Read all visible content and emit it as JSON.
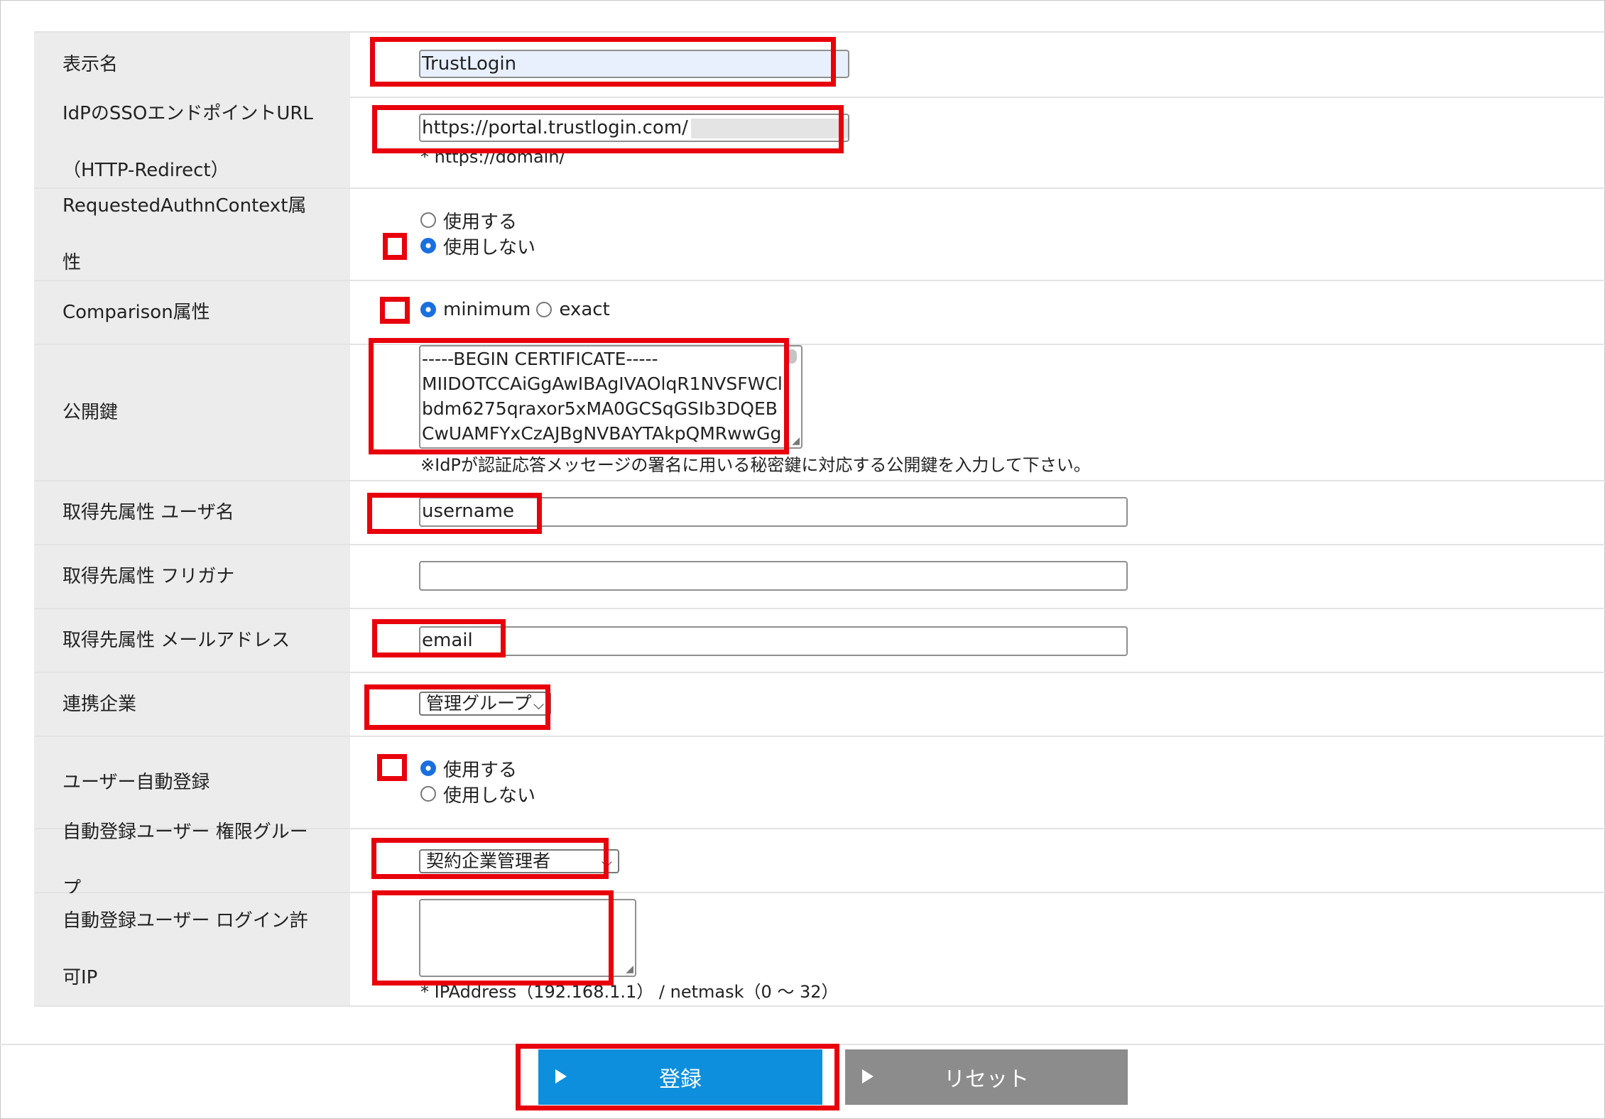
{
  "form": {
    "display_name": {
      "label": "表示名",
      "value": "TrustLogin"
    },
    "sso_url": {
      "label_line1": "IdPのSSOエンドポイントURL",
      "label_line2": "（HTTP-Redirect）",
      "value": "https://portal.trustlogin.com/",
      "hint": "* https://domain/"
    },
    "authn_context": {
      "label_line1": "RequestedAuthnContext属",
      "label_line2": "性",
      "option_use": "使用する",
      "option_nouse": "使用しない",
      "selected": "使用しない"
    },
    "comparison": {
      "label": "Comparison属性",
      "option_min": "minimum",
      "option_exact": "exact",
      "selected": "minimum"
    },
    "public_key": {
      "label": "公開鍵",
      "lines": [
        "-----BEGIN CERTIFICATE-----",
        "MIIDOTCCAiGgAwIBAgIVAOlqR1NVSFWCl",
        "bdm6275qraxor5xMA0GCSqGSIb3DQEB",
        "CwUAMFYxCzAJBgNVBAYTAkpQMRwwGg"
      ],
      "note": "※IdPが認証応答メッセージの署名に用いる秘密鍵に対応する公開鍵を入力して下さい。"
    },
    "attr_username": {
      "label": "取得先属性 ユーザ名",
      "value": "username"
    },
    "attr_furigana": {
      "label": "取得先属性 フリガナ",
      "value": ""
    },
    "attr_email": {
      "label": "取得先属性 メールアドレス",
      "value": "email"
    },
    "company": {
      "label": "連携企業",
      "value": "管理グループ"
    },
    "auto_register": {
      "label": "ユーザー自動登録",
      "option_use": "使用する",
      "option_nouse": "使用しない",
      "selected": "使用する"
    },
    "auto_group": {
      "label_line1": "自動登録ユーザー 権限グルー",
      "label_line2": "プ",
      "value": "契約企業管理者"
    },
    "auto_ip": {
      "label_line1": "自動登録ユーザー ログイン許",
      "label_line2": "可IP",
      "value": "",
      "hint": "* IPAddress（192.168.1.1） / netmask（0 ～ 32）"
    }
  },
  "buttons": {
    "submit": "登録",
    "reset": "リセット"
  },
  "colors": {
    "highlight": "#e8000b",
    "submit_bg": "#0e8fde",
    "reset_bg": "#8c8c8c"
  }
}
